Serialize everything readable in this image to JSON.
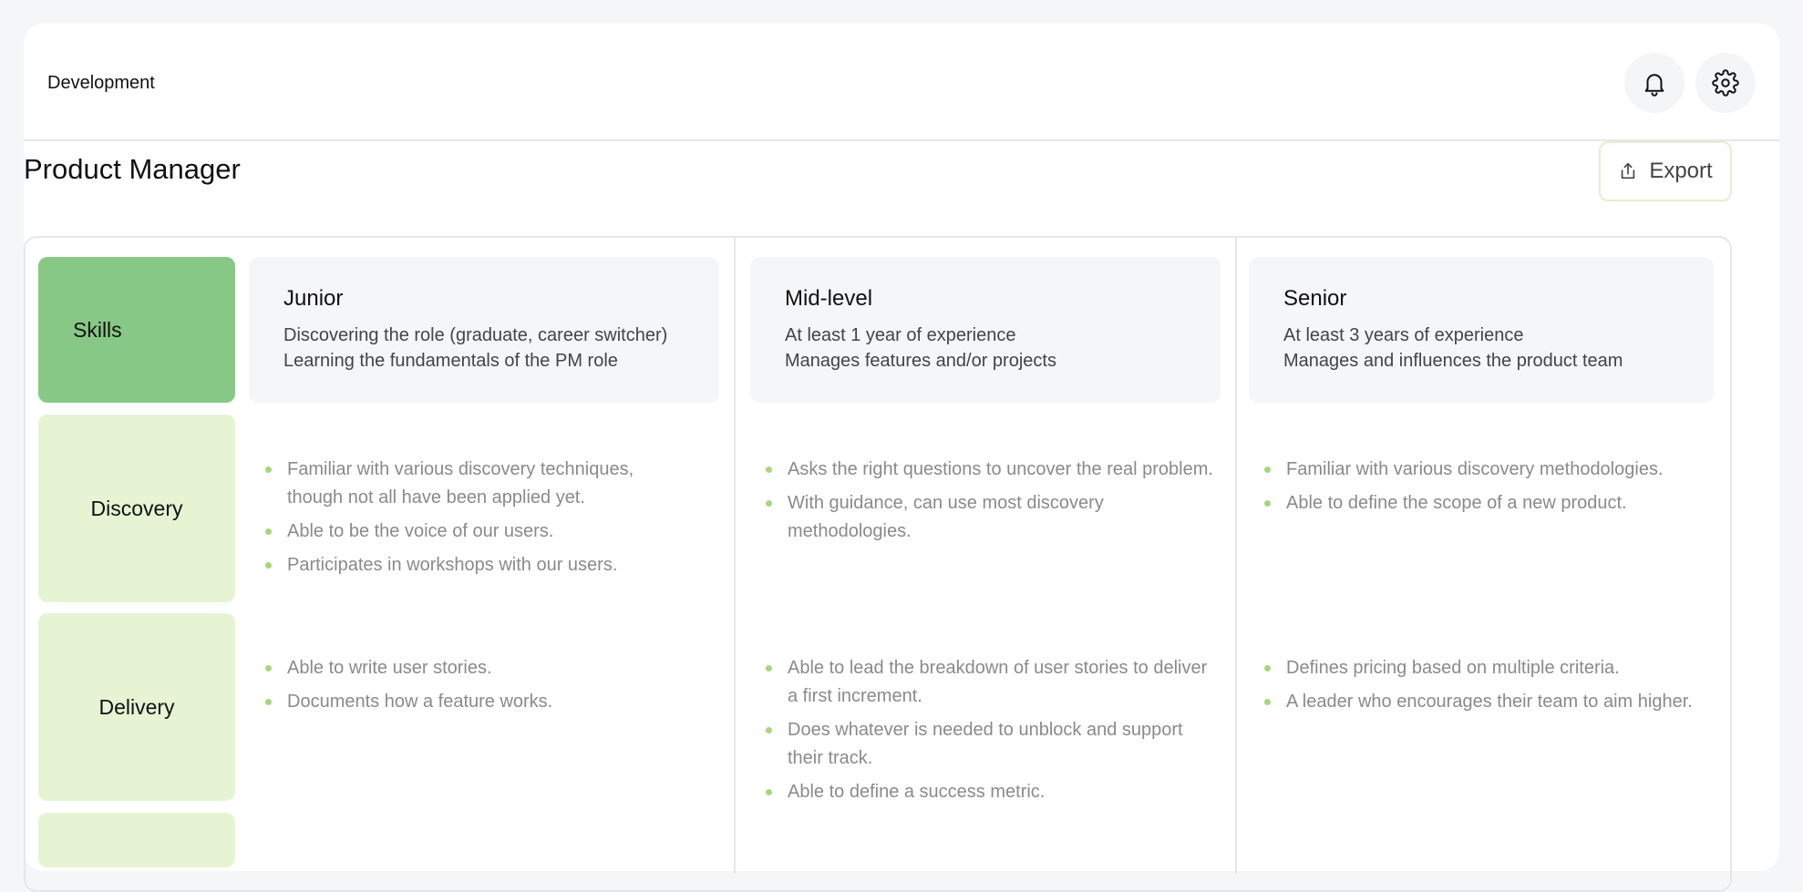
{
  "breadcrumb": "Development",
  "page_title": "Product Manager",
  "export_label": "Export",
  "icons": {
    "bell": "bell-icon",
    "gear": "gear-icon",
    "export": "share-icon"
  },
  "colors": {
    "skills_label_bg": "#87c887",
    "row_label_bg": "#e6f4d4",
    "bullet": "#a6d77a",
    "level_card_bg": "#f5f6f8"
  },
  "matrix": {
    "header_label": "Skills",
    "levels": [
      {
        "title": "Junior",
        "line1": "Discovering the role (graduate, career switcher)",
        "line2": "Learning the fundamentals of the PM role"
      },
      {
        "title": "Mid-level",
        "line1": "At least 1 year of experience",
        "line2": "Manages features and/or projects"
      },
      {
        "title": "Senior",
        "line1": "At least 3 years of experience",
        "line2": "Manages and influences the product team"
      }
    ],
    "rows": [
      {
        "label": "Discovery",
        "cells": [
          [
            "Familiar with various discovery techniques, though not all have been applied yet.",
            "Able to be the voice of our users.",
            "Participates in workshops with our users."
          ],
          [
            "Asks the right questions to uncover the real problem.",
            "With guidance, can use most discovery methodologies."
          ],
          [
            "Familiar with various discovery methodologies.",
            "Able to define the scope of a new product."
          ]
        ]
      },
      {
        "label": "Delivery",
        "cells": [
          [
            "Able to write user stories.",
            "Documents how a feature works."
          ],
          [
            "Able to lead the breakdown of user stories to deliver a first increment.",
            "Does whatever is needed to unblock and support their track.",
            "Able to define a success metric."
          ],
          [
            "Defines pricing based on multiple criteria.",
            "A leader who encourages their team to aim higher."
          ]
        ]
      }
    ]
  }
}
